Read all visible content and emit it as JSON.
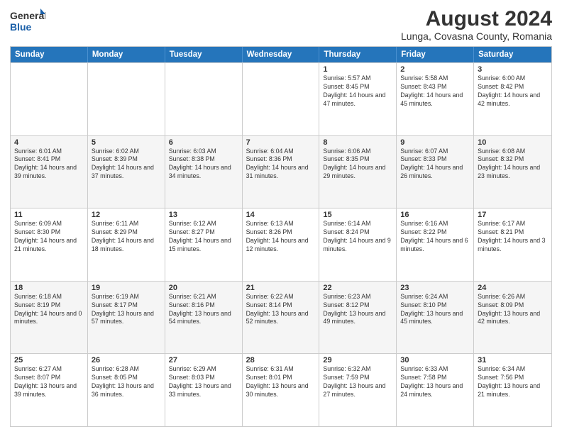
{
  "logo": {
    "general": "General",
    "blue": "Blue"
  },
  "title": "August 2024",
  "subtitle": "Lunga, Covasna County, Romania",
  "weekdays": [
    "Sunday",
    "Monday",
    "Tuesday",
    "Wednesday",
    "Thursday",
    "Friday",
    "Saturday"
  ],
  "weeks": [
    [
      {
        "day": "",
        "sunrise": "",
        "sunset": "",
        "daylight": ""
      },
      {
        "day": "",
        "sunrise": "",
        "sunset": "",
        "daylight": ""
      },
      {
        "day": "",
        "sunrise": "",
        "sunset": "",
        "daylight": ""
      },
      {
        "day": "",
        "sunrise": "",
        "sunset": "",
        "daylight": ""
      },
      {
        "day": "1",
        "sunrise": "Sunrise: 5:57 AM",
        "sunset": "Sunset: 8:45 PM",
        "daylight": "Daylight: 14 hours and 47 minutes."
      },
      {
        "day": "2",
        "sunrise": "Sunrise: 5:58 AM",
        "sunset": "Sunset: 8:43 PM",
        "daylight": "Daylight: 14 hours and 45 minutes."
      },
      {
        "day": "3",
        "sunrise": "Sunrise: 6:00 AM",
        "sunset": "Sunset: 8:42 PM",
        "daylight": "Daylight: 14 hours and 42 minutes."
      }
    ],
    [
      {
        "day": "4",
        "sunrise": "Sunrise: 6:01 AM",
        "sunset": "Sunset: 8:41 PM",
        "daylight": "Daylight: 14 hours and 39 minutes."
      },
      {
        "day": "5",
        "sunrise": "Sunrise: 6:02 AM",
        "sunset": "Sunset: 8:39 PM",
        "daylight": "Daylight: 14 hours and 37 minutes."
      },
      {
        "day": "6",
        "sunrise": "Sunrise: 6:03 AM",
        "sunset": "Sunset: 8:38 PM",
        "daylight": "Daylight: 14 hours and 34 minutes."
      },
      {
        "day": "7",
        "sunrise": "Sunrise: 6:04 AM",
        "sunset": "Sunset: 8:36 PM",
        "daylight": "Daylight: 14 hours and 31 minutes."
      },
      {
        "day": "8",
        "sunrise": "Sunrise: 6:06 AM",
        "sunset": "Sunset: 8:35 PM",
        "daylight": "Daylight: 14 hours and 29 minutes."
      },
      {
        "day": "9",
        "sunrise": "Sunrise: 6:07 AM",
        "sunset": "Sunset: 8:33 PM",
        "daylight": "Daylight: 14 hours and 26 minutes."
      },
      {
        "day": "10",
        "sunrise": "Sunrise: 6:08 AM",
        "sunset": "Sunset: 8:32 PM",
        "daylight": "Daylight: 14 hours and 23 minutes."
      }
    ],
    [
      {
        "day": "11",
        "sunrise": "Sunrise: 6:09 AM",
        "sunset": "Sunset: 8:30 PM",
        "daylight": "Daylight: 14 hours and 21 minutes."
      },
      {
        "day": "12",
        "sunrise": "Sunrise: 6:11 AM",
        "sunset": "Sunset: 8:29 PM",
        "daylight": "Daylight: 14 hours and 18 minutes."
      },
      {
        "day": "13",
        "sunrise": "Sunrise: 6:12 AM",
        "sunset": "Sunset: 8:27 PM",
        "daylight": "Daylight: 14 hours and 15 minutes."
      },
      {
        "day": "14",
        "sunrise": "Sunrise: 6:13 AM",
        "sunset": "Sunset: 8:26 PM",
        "daylight": "Daylight: 14 hours and 12 minutes."
      },
      {
        "day": "15",
        "sunrise": "Sunrise: 6:14 AM",
        "sunset": "Sunset: 8:24 PM",
        "daylight": "Daylight: 14 hours and 9 minutes."
      },
      {
        "day": "16",
        "sunrise": "Sunrise: 6:16 AM",
        "sunset": "Sunset: 8:22 PM",
        "daylight": "Daylight: 14 hours and 6 minutes."
      },
      {
        "day": "17",
        "sunrise": "Sunrise: 6:17 AM",
        "sunset": "Sunset: 8:21 PM",
        "daylight": "Daylight: 14 hours and 3 minutes."
      }
    ],
    [
      {
        "day": "18",
        "sunrise": "Sunrise: 6:18 AM",
        "sunset": "Sunset: 8:19 PM",
        "daylight": "Daylight: 14 hours and 0 minutes."
      },
      {
        "day": "19",
        "sunrise": "Sunrise: 6:19 AM",
        "sunset": "Sunset: 8:17 PM",
        "daylight": "Daylight: 13 hours and 57 minutes."
      },
      {
        "day": "20",
        "sunrise": "Sunrise: 6:21 AM",
        "sunset": "Sunset: 8:16 PM",
        "daylight": "Daylight: 13 hours and 54 minutes."
      },
      {
        "day": "21",
        "sunrise": "Sunrise: 6:22 AM",
        "sunset": "Sunset: 8:14 PM",
        "daylight": "Daylight: 13 hours and 52 minutes."
      },
      {
        "day": "22",
        "sunrise": "Sunrise: 6:23 AM",
        "sunset": "Sunset: 8:12 PM",
        "daylight": "Daylight: 13 hours and 49 minutes."
      },
      {
        "day": "23",
        "sunrise": "Sunrise: 6:24 AM",
        "sunset": "Sunset: 8:10 PM",
        "daylight": "Daylight: 13 hours and 45 minutes."
      },
      {
        "day": "24",
        "sunrise": "Sunrise: 6:26 AM",
        "sunset": "Sunset: 8:09 PM",
        "daylight": "Daylight: 13 hours and 42 minutes."
      }
    ],
    [
      {
        "day": "25",
        "sunrise": "Sunrise: 6:27 AM",
        "sunset": "Sunset: 8:07 PM",
        "daylight": "Daylight: 13 hours and 39 minutes."
      },
      {
        "day": "26",
        "sunrise": "Sunrise: 6:28 AM",
        "sunset": "Sunset: 8:05 PM",
        "daylight": "Daylight: 13 hours and 36 minutes."
      },
      {
        "day": "27",
        "sunrise": "Sunrise: 6:29 AM",
        "sunset": "Sunset: 8:03 PM",
        "daylight": "Daylight: 13 hours and 33 minutes."
      },
      {
        "day": "28",
        "sunrise": "Sunrise: 6:31 AM",
        "sunset": "Sunset: 8:01 PM",
        "daylight": "Daylight: 13 hours and 30 minutes."
      },
      {
        "day": "29",
        "sunrise": "Sunrise: 6:32 AM",
        "sunset": "Sunset: 7:59 PM",
        "daylight": "Daylight: 13 hours and 27 minutes."
      },
      {
        "day": "30",
        "sunrise": "Sunrise: 6:33 AM",
        "sunset": "Sunset: 7:58 PM",
        "daylight": "Daylight: 13 hours and 24 minutes."
      },
      {
        "day": "31",
        "sunrise": "Sunrise: 6:34 AM",
        "sunset": "Sunset: 7:56 PM",
        "daylight": "Daylight: 13 hours and 21 minutes."
      }
    ]
  ]
}
